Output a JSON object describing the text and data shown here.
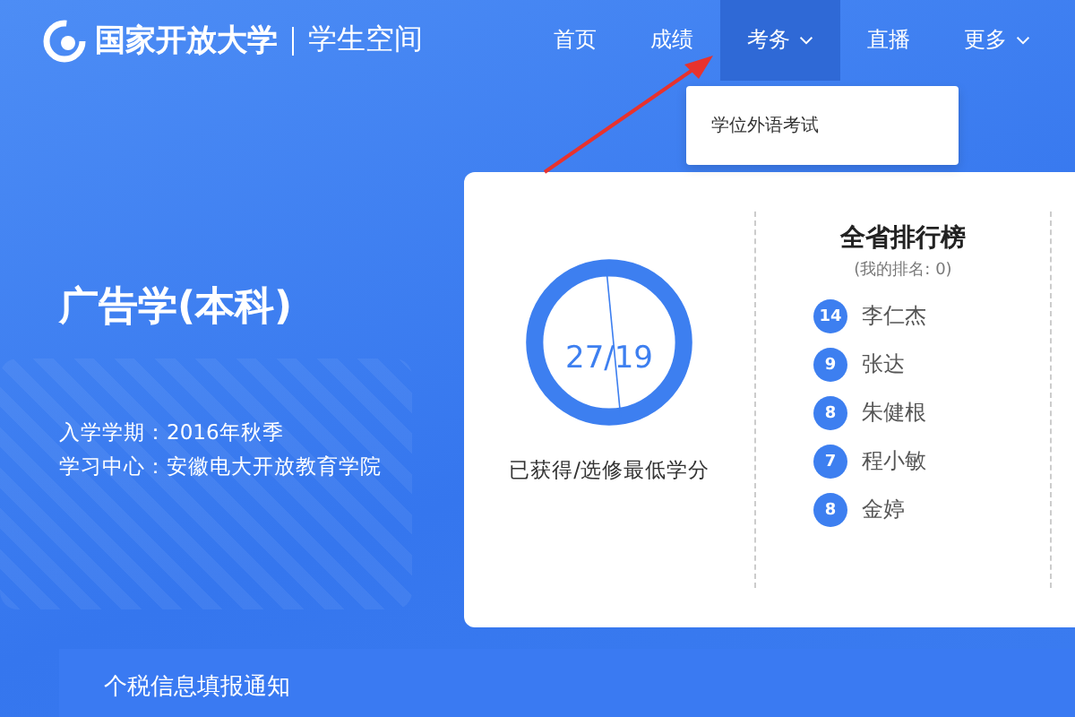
{
  "header": {
    "logo_text": "国家开放大学",
    "site_name": "学生空间"
  },
  "nav": [
    {
      "label": "首页",
      "selected": false,
      "dropdown": false
    },
    {
      "label": "成绩",
      "selected": false,
      "dropdown": false
    },
    {
      "label": "考务",
      "selected": true,
      "dropdown": true
    },
    {
      "label": "直播",
      "selected": false,
      "dropdown": false
    },
    {
      "label": "更多",
      "selected": false,
      "dropdown": true
    }
  ],
  "dropdown_menu": {
    "items": [
      "学位外语考试"
    ]
  },
  "program": {
    "title": "广告学(本科)",
    "details": [
      "入学学期：2016年秋季",
      "学习中心：安徽电大开放教育学院"
    ]
  },
  "credits": {
    "value": "27/19",
    "caption": "已获得/选修最低学分"
  },
  "ranking": {
    "title": "全省排行榜",
    "subtitle": "(我的排名: 0)",
    "rows": [
      {
        "score": "14",
        "name": "李仁杰"
      },
      {
        "score": "9",
        "name": "张达"
      },
      {
        "score": "8",
        "name": "朱健根"
      },
      {
        "score": "7",
        "name": "程小敏"
      },
      {
        "score": "8",
        "name": "金婷"
      }
    ]
  },
  "notice": {
    "title": "个税信息填报通知"
  }
}
